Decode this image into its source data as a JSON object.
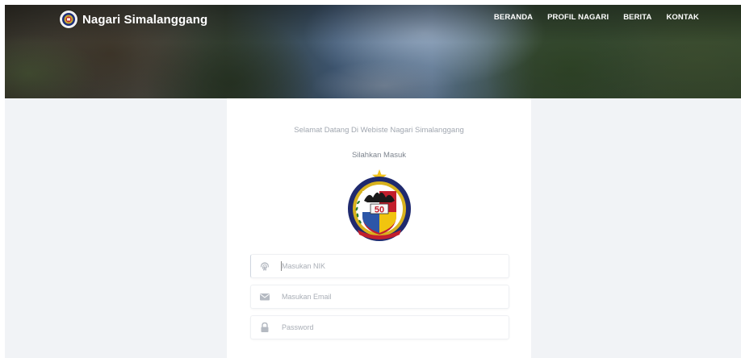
{
  "header": {
    "brand_title": "Nagari Simalanggang",
    "nav": [
      {
        "label": "BERANDA"
      },
      {
        "label": "PROFIL NAGARI"
      },
      {
        "label": "BERITA"
      },
      {
        "label": "KONTAK"
      }
    ]
  },
  "login": {
    "welcome_text": "Selamat Datang Di Webiste Nagari Simalanggang",
    "prompt_text": "Silahkan Masuk",
    "emblem_number": "50",
    "fields": {
      "nik": {
        "placeholder": "Masukan NIK",
        "icon": "fingerprint-icon"
      },
      "email": {
        "placeholder": "Masukan Email",
        "icon": "envelope-icon"
      },
      "password": {
        "placeholder": "Password",
        "icon": "lock-icon"
      }
    }
  },
  "colors": {
    "page_bg": "#f1f3f6",
    "card_bg": "#ffffff",
    "muted_text": "#a1a7b0",
    "icon_gray": "#b5bac2"
  }
}
